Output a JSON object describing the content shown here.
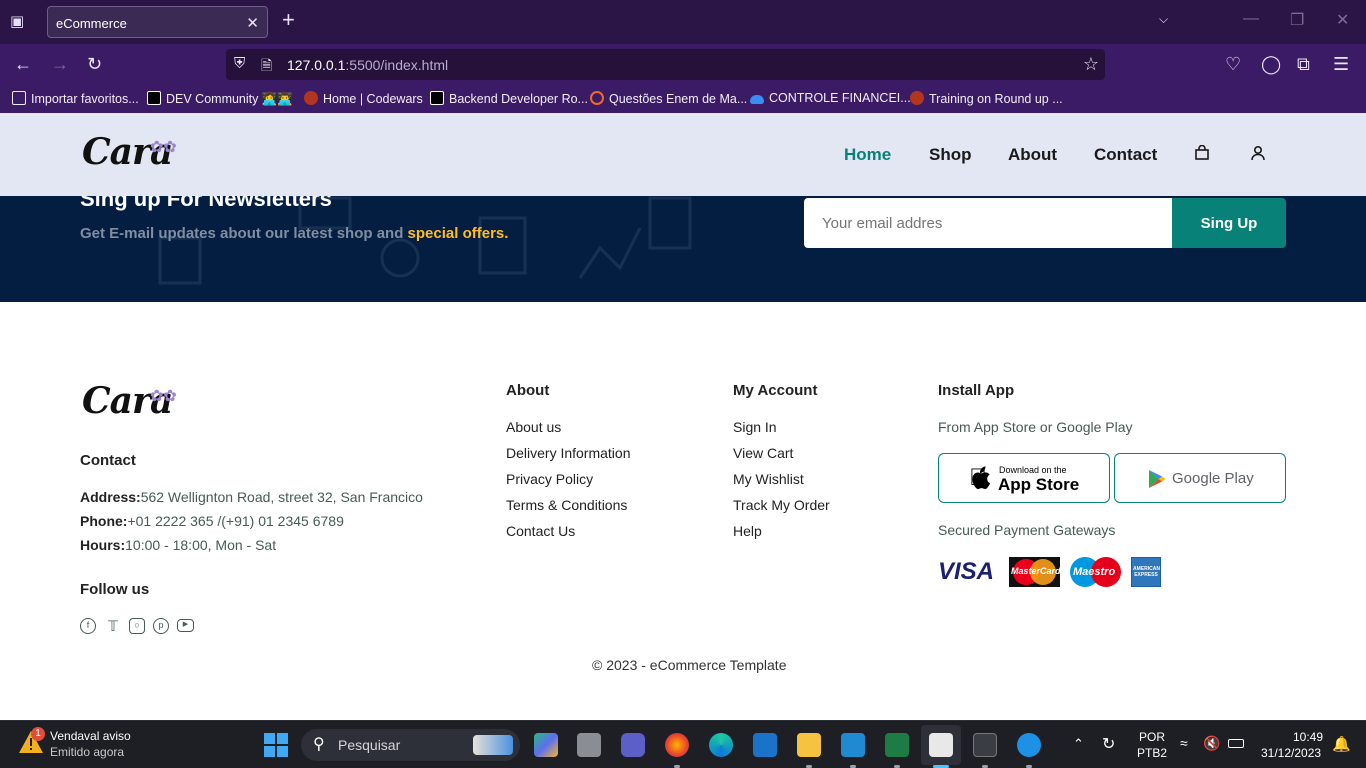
{
  "browser": {
    "tab_title": "eCommerce",
    "url_host": "127.0.0.1",
    "url_rest": ":5500/index.html",
    "bookmarks": [
      {
        "label": "Importar favoritos..."
      },
      {
        "label": "DEV Community 👩‍💻👨‍💻"
      },
      {
        "label": "Home | Codewars"
      },
      {
        "label": "Backend Developer Ro..."
      },
      {
        "label": "Questões Enem de Ma..."
      },
      {
        "label": "CONTROLE FINANCEI..."
      },
      {
        "label": "Training on Round up ..."
      }
    ]
  },
  "header": {
    "logo_text": "Cara",
    "nav": [
      {
        "label": "Home"
      },
      {
        "label": "Shop"
      },
      {
        "label": "About"
      },
      {
        "label": "Contact"
      }
    ]
  },
  "newsletter": {
    "title": "Sing up For Newsletters",
    "desc_prefix": "Get E-mail updates about our latest shop and ",
    "desc_highlight": "special offers",
    "desc_suffix": ".",
    "email_placeholder": "Your email addres",
    "button_label": "Sing Up"
  },
  "footer": {
    "contact_heading": "Contact",
    "address_label": "Address:",
    "address_value": "562 Wellignton Road, street 32, San Francico",
    "phone_label": "Phone:",
    "phone_value": "+01 2222 365 /(+91) 01 2345 6789",
    "hours_label": "Hours:",
    "hours_value": "10:00 - 18:00, Mon - Sat",
    "follow_heading": "Follow us",
    "about_heading": "About",
    "about_links": [
      {
        "label": "About us"
      },
      {
        "label": "Delivery Information"
      },
      {
        "label": "Privacy Policy"
      },
      {
        "label": "Terms & Conditions"
      },
      {
        "label": "Contact Us"
      }
    ],
    "account_heading": "My Account",
    "account_links": [
      {
        "label": "Sign In"
      },
      {
        "label": "View Cart"
      },
      {
        "label": "My Wishlist"
      },
      {
        "label": "Track My Order"
      },
      {
        "label": "Help"
      }
    ],
    "install_heading": "Install App",
    "install_text": "From App Store or Google Play",
    "appstore_small": "Download on the",
    "appstore_big": "App Store",
    "googleplay_label": "Google Play",
    "payment_text": "Secured Payment Gateways",
    "payment_logos": {
      "visa": "VISA",
      "mastercard": "MasterCard",
      "maestro": "Maestro",
      "amex": "AMERICAN EXPRESS"
    },
    "copyright": "© 2023 - eCommerce Template"
  },
  "taskbar": {
    "notification_title": "Vendaval aviso",
    "notification_sub": "Emitido agora",
    "notification_badge": "1",
    "search_placeholder": "Pesquisar",
    "lang_top": "POR",
    "lang_bottom": "PTB2",
    "time": "10:49",
    "date": "31/12/2023"
  }
}
